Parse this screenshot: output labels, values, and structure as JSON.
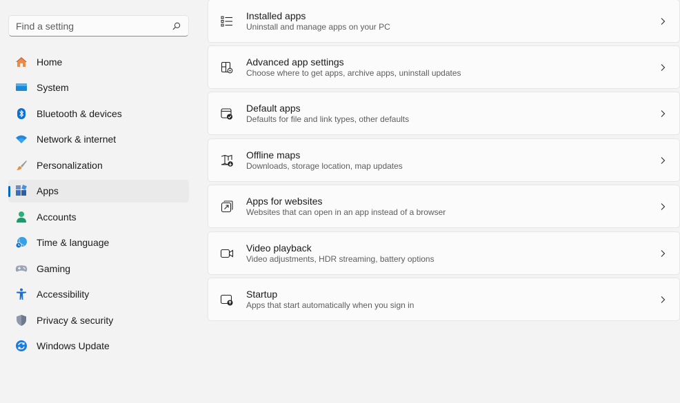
{
  "search": {
    "placeholder": "Find a setting"
  },
  "sidebar": {
    "items": [
      {
        "label": "Home"
      },
      {
        "label": "System"
      },
      {
        "label": "Bluetooth & devices"
      },
      {
        "label": "Network & internet"
      },
      {
        "label": "Personalization"
      },
      {
        "label": "Apps",
        "selected": true
      },
      {
        "label": "Accounts"
      },
      {
        "label": "Time & language"
      },
      {
        "label": "Gaming"
      },
      {
        "label": "Accessibility"
      },
      {
        "label": "Privacy & security"
      },
      {
        "label": "Windows Update"
      }
    ]
  },
  "main": {
    "cards": [
      {
        "title": "Installed apps",
        "subtitle": "Uninstall and manage apps on your PC",
        "icon": "list-icon"
      },
      {
        "title": "Advanced app settings",
        "subtitle": "Choose where to get apps, archive apps, uninstall updates",
        "icon": "app-settings-icon"
      },
      {
        "title": "Default apps",
        "subtitle": "Defaults for file and link types, other defaults",
        "icon": "default-apps-icon"
      },
      {
        "title": "Offline maps",
        "subtitle": "Downloads, storage location, map updates",
        "icon": "map-icon"
      },
      {
        "title": "Apps for websites",
        "subtitle": "Websites that can open in an app instead of a browser",
        "icon": "open-in-app-icon"
      },
      {
        "title": "Video playback",
        "subtitle": "Video adjustments, HDR streaming, battery options",
        "icon": "video-icon"
      },
      {
        "title": "Startup",
        "subtitle": "Apps that start automatically when you sign in",
        "icon": "startup-icon"
      }
    ]
  },
  "colors": {
    "accent": "#0067c0",
    "background": "#f3f3f3",
    "card": "#fbfbfb"
  }
}
